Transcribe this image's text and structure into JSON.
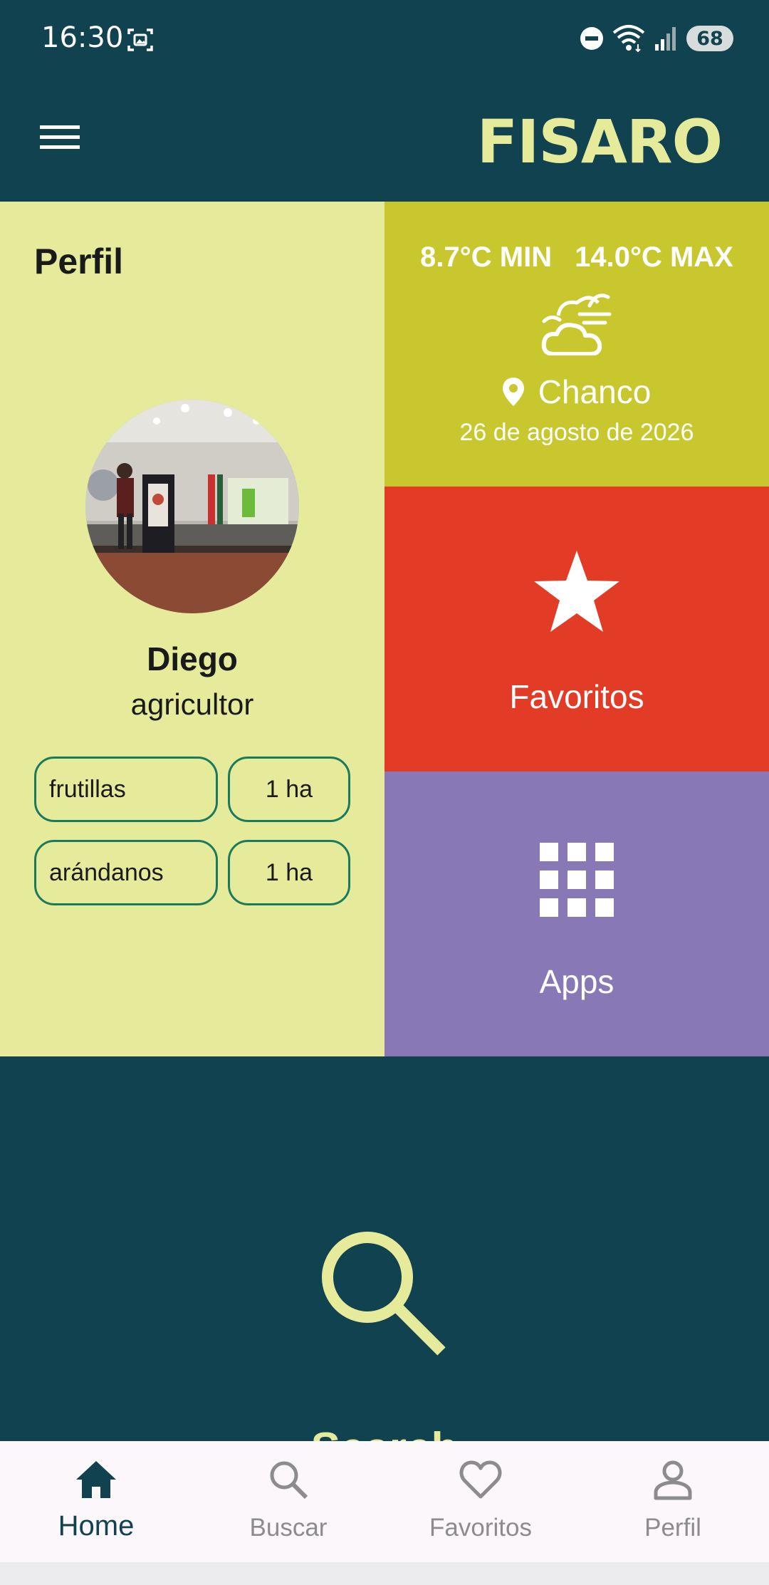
{
  "status_bar": {
    "time": "16:30",
    "battery": "68"
  },
  "app_bar": {
    "brand": "FISARO",
    "menu_icon": "hamburger-menu-icon"
  },
  "profile": {
    "title": "Perfil",
    "name": "Diego",
    "role": "agricultor",
    "crops": [
      {
        "name": "frutillas",
        "area": "1 ha"
      },
      {
        "name": "arándanos",
        "area": "1 ha"
      }
    ]
  },
  "weather": {
    "min": "8.7°C MIN",
    "max": "14.0°C MAX",
    "icon": "cloudy-wind-icon",
    "location": "Chanco",
    "date": "26 de agosto de 2026"
  },
  "tiles": {
    "favorites_label": "Favoritos",
    "favorites_icon": "star-icon",
    "apps_label": "Apps",
    "apps_icon": "grid-icon"
  },
  "search_tile": {
    "label": "Search",
    "icon": "search-icon"
  },
  "bottom_nav": {
    "items": [
      {
        "label": "Home",
        "icon": "home-icon",
        "active": true
      },
      {
        "label": "Buscar",
        "icon": "search-icon",
        "active": false
      },
      {
        "label": "Favoritos",
        "icon": "heart-icon",
        "active": false
      },
      {
        "label": "Perfil",
        "icon": "person-icon",
        "active": false
      }
    ]
  },
  "colors": {
    "primary_dark": "#11424f",
    "accent_lime": "#e6eb9c",
    "weather_olive": "#c8c72e",
    "favorites_red": "#e23c26",
    "apps_purple": "#8879b6",
    "chip_border": "#1a7a5c"
  }
}
